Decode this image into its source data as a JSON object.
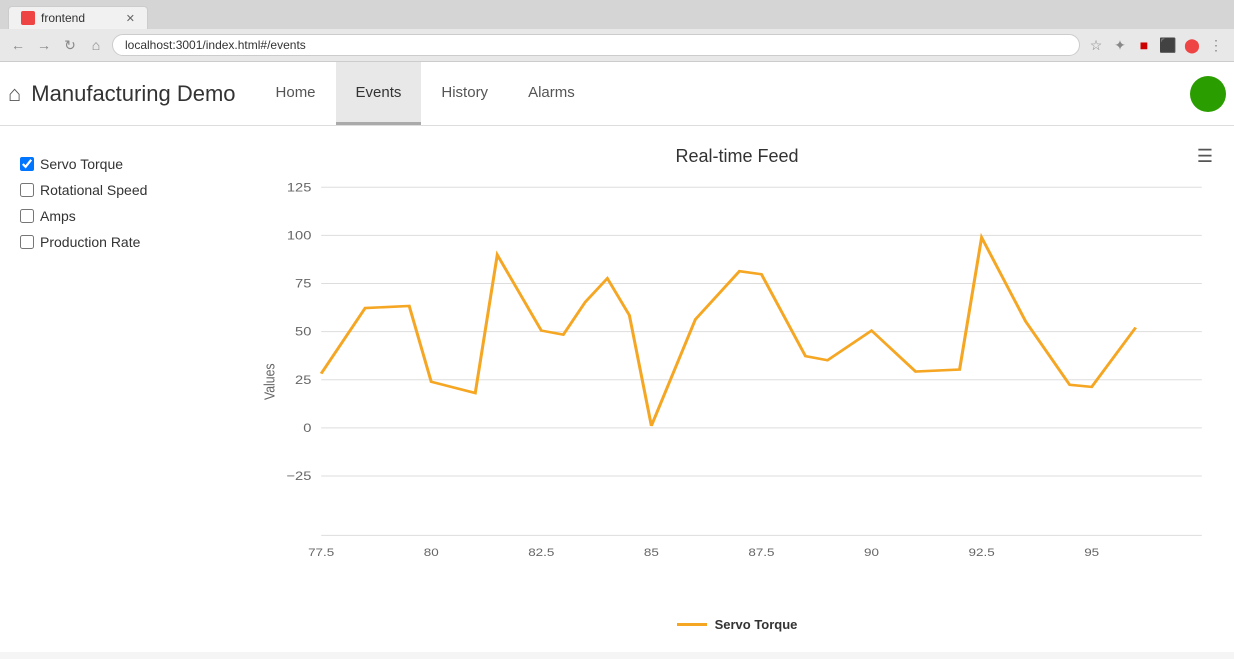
{
  "browser": {
    "tab_label": "frontend",
    "url": "localhost:3001/index.html#/events"
  },
  "app": {
    "brand": "Manufacturing Demo",
    "nav_links": [
      {
        "label": "Home",
        "active": false,
        "id": "home"
      },
      {
        "label": "Events",
        "active": true,
        "id": "events"
      },
      {
        "label": "History",
        "active": false,
        "id": "history"
      },
      {
        "label": "Alarms",
        "active": false,
        "id": "alarms"
      }
    ]
  },
  "sidebar": {
    "items": [
      {
        "label": "Servo Torque",
        "checked": true
      },
      {
        "label": "Rotational Speed",
        "checked": false
      },
      {
        "label": "Amps",
        "checked": false
      },
      {
        "label": "Production Rate",
        "checked": false
      }
    ]
  },
  "chart": {
    "title": "Real-time Feed",
    "legend": "Servo Torque",
    "y_axis_label": "Values",
    "y_ticks": [
      "125",
      "100",
      "75",
      "50",
      "25",
      "0",
      "-25"
    ],
    "x_ticks": [
      "77.5",
      "80",
      "82.5",
      "85",
      "87.5",
      "90",
      "92.5",
      "95"
    ],
    "color": "#f5a623",
    "data_points": [
      {
        "x": 77.5,
        "y": 28
      },
      {
        "x": 78.5,
        "y": 62
      },
      {
        "x": 79.5,
        "y": 63
      },
      {
        "x": 80.0,
        "y": 24
      },
      {
        "x": 81.0,
        "y": 18
      },
      {
        "x": 81.5,
        "y": 89
      },
      {
        "x": 82.5,
        "y": 50
      },
      {
        "x": 83.0,
        "y": 48
      },
      {
        "x": 83.5,
        "y": 65
      },
      {
        "x": 84.0,
        "y": 77
      },
      {
        "x": 84.5,
        "y": 58
      },
      {
        "x": 85.0,
        "y": 1
      },
      {
        "x": 86.0,
        "y": 56
      },
      {
        "x": 87.0,
        "y": 81
      },
      {
        "x": 87.5,
        "y": 79
      },
      {
        "x": 88.5,
        "y": 37
      },
      {
        "x": 89.0,
        "y": 35
      },
      {
        "x": 90.0,
        "y": 50
      },
      {
        "x": 91.0,
        "y": 29
      },
      {
        "x": 92.0,
        "y": 30
      },
      {
        "x": 92.5,
        "y": 98
      },
      {
        "x": 93.5,
        "y": 55
      },
      {
        "x": 94.5,
        "y": 22
      },
      {
        "x": 95.0,
        "y": 21
      },
      {
        "x": 96.0,
        "y": 52
      }
    ]
  }
}
